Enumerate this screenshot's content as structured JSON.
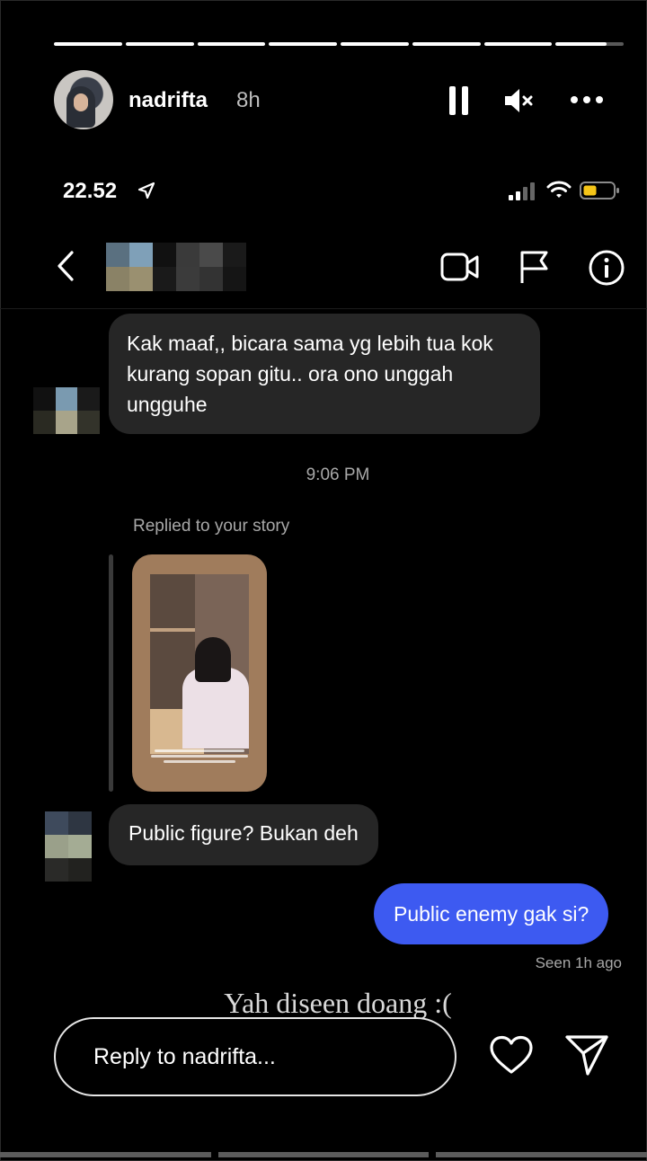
{
  "story": {
    "username": "nadrifta",
    "time": "8h",
    "progress": [
      1,
      1,
      1,
      1,
      1,
      1,
      1,
      0.75
    ]
  },
  "phone_status": {
    "clock": "22.52"
  },
  "chat": {
    "messages": [
      {
        "from": "other",
        "text": "Kak maaf,, bicara sama yg lebih tua kok kurang sopan gitu.. ora ono unggah ungguhe"
      },
      {
        "from": "system",
        "text": "9:06 PM"
      },
      {
        "from": "other",
        "reply_label": "Replied to your story",
        "text": "Public figure? Bukan deh"
      },
      {
        "from": "me",
        "text": "Public enemy gak si?",
        "status": "Seen 1h ago"
      }
    ]
  },
  "overlay_text": "Yah diseen doang :(",
  "composer": {
    "placeholder": "Reply to nadrifta..."
  },
  "colors": {
    "background": "#000000",
    "incoming_bubble": "#262626",
    "outgoing_bubble": "#3d5af1",
    "battery": "#f5c518"
  },
  "icons": [
    "pause-icon",
    "mute-icon",
    "more-icon",
    "location-arrow-icon",
    "signal-icon",
    "wifi-icon",
    "battery-icon",
    "back-icon",
    "video-call-icon",
    "flag-icon",
    "info-icon",
    "heart-icon",
    "send-icon"
  ]
}
